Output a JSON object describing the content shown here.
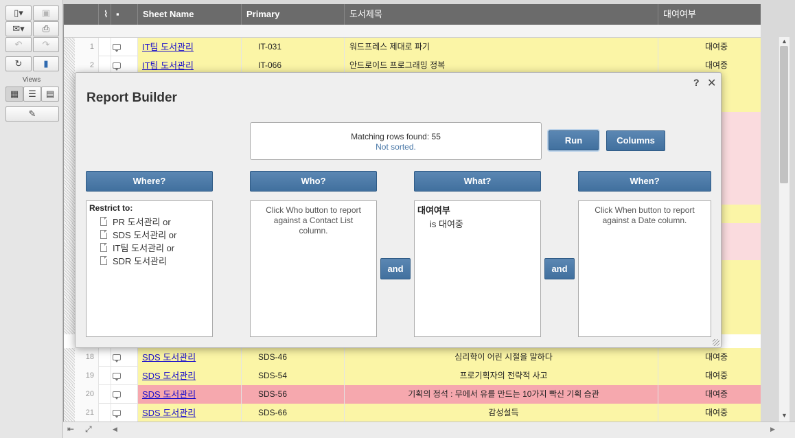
{
  "toolbar": {
    "views_label": "Views"
  },
  "grid": {
    "columns": [
      "Sheet Name",
      "Primary",
      "도서제목",
      "대여여부"
    ],
    "top_rows": [
      {
        "num": "1",
        "sheet": "IT팀 도서관리",
        "primary": "IT-031",
        "title": "워드프레스 제대로 파기",
        "status": "대여중",
        "bg": "#fbf5a6"
      },
      {
        "num": "2",
        "sheet": "IT팀 도서관리",
        "primary": "IT-066",
        "title": "안드로이드 프로그래밍 정복",
        "status": "대여중",
        "bg": "#fbf5a6"
      }
    ],
    "bottom_rows": [
      {
        "num": "18",
        "sheet": "SDS 도서관리",
        "primary": "SDS-46",
        "title": "심리학이 어린 시절을 말하다",
        "status": "대여중",
        "bg": "#fbf5a6"
      },
      {
        "num": "19",
        "sheet": "SDS 도서관리",
        "primary": "SDS-54",
        "title": "프로기획자의 전략적 사고",
        "status": "대여중",
        "bg": "#fbf5a6"
      },
      {
        "num": "20",
        "sheet": "SDS 도서관리",
        "primary": "SDS-56",
        "title": "기획의 정석 : 무에서 유를 만드는 10가지 빡신 기획 습관",
        "status": "대여중",
        "bg": "#f6a8ae"
      },
      {
        "num": "21",
        "sheet": "SDS 도서관리",
        "primary": "SDS-66",
        "title": "감성설득",
        "status": "대여중",
        "bg": "#fbf5a6"
      }
    ],
    "hidden_row_colors": [
      "#fbf5a6",
      "#fbf5a6",
      "#fadbde",
      "#fadbde",
      "#fadbde",
      "#fadbde",
      "#fadbde",
      "#fbf5a6",
      "#fadbde",
      "#fadbde",
      "#fbf5a6",
      "#fbf5a6",
      "#fbf5a6",
      "#fbf5a6"
    ]
  },
  "report_builder": {
    "title": "Report Builder",
    "help": "?",
    "close": "✕",
    "matching_text": "Matching rows found: 55",
    "sort_text": "Not sorted.",
    "run_label": "Run",
    "columns_label": "Columns",
    "where_label": "Where?",
    "who_label": "Who?",
    "what_label": "What?",
    "when_label": "When?",
    "and_label": "and",
    "restrict_title": "Restrict to:",
    "restrict_items": [
      "PR 도서관리 or",
      "SDS 도서관리 or",
      "IT팀 도서관리 or",
      "SDR 도서관리"
    ],
    "who_hint": "Click Who button to report against a Contact List column.",
    "what_column": "대여여부",
    "what_condition": "is 대여중",
    "when_hint": "Click When button to report against a Date column."
  },
  "colors": {
    "header": "#6b6b6b",
    "button": "#4a79a6",
    "link": "#1a0dcc"
  }
}
